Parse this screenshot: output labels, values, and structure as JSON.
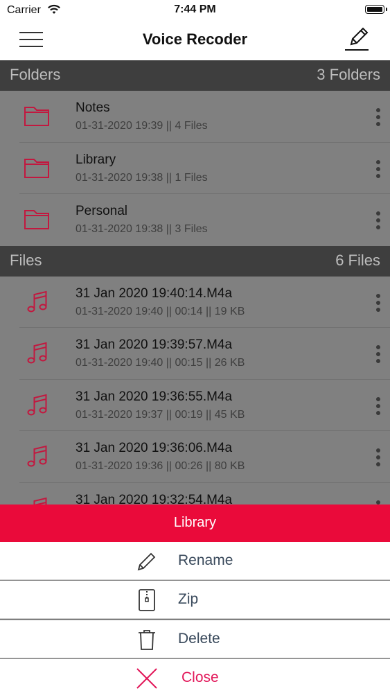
{
  "status_bar": {
    "carrier": "Carrier",
    "time": "7:44 PM"
  },
  "nav": {
    "title": "Voice Recoder",
    "menu_icon": "hamburger-menu-icon",
    "edit_icon": "pencil-icon"
  },
  "folders_section": {
    "label": "Folders",
    "count": "3 Folders"
  },
  "folders": [
    {
      "name": "Notes",
      "meta": "01-31-2020 19:39 || 4 Files"
    },
    {
      "name": "Library",
      "meta": "01-31-2020 19:38 || 1 Files"
    },
    {
      "name": "Personal",
      "meta": "01-31-2020 19:38 || 3 Files"
    }
  ],
  "files_section": {
    "label": "Files",
    "count": "6 Files"
  },
  "files": [
    {
      "name": "31 Jan 2020 19:40:14.M4a",
      "meta": "01-31-2020 19:40 || 00:14 || 19 KB"
    },
    {
      "name": "31 Jan 2020 19:39:57.M4a",
      "meta": "01-31-2020 19:40 || 00:15 || 26 KB"
    },
    {
      "name": "31 Jan 2020 19:36:55.M4a",
      "meta": "01-31-2020 19:37 || 00:19 || 45 KB"
    },
    {
      "name": "31 Jan 2020 19:36:06.M4a",
      "meta": "01-31-2020 19:36 || 00:26 || 80 KB"
    },
    {
      "name": "31 Jan 2020 19:32:54.M4a",
      "meta": ""
    }
  ],
  "action_sheet": {
    "title": "Library",
    "rename": "Rename",
    "zip": "Zip",
    "delete": "Delete",
    "close": "Close"
  },
  "colors": {
    "accent": "#ea0a3a",
    "icon_red": "#c2183f",
    "close_red": "#e2185a"
  }
}
